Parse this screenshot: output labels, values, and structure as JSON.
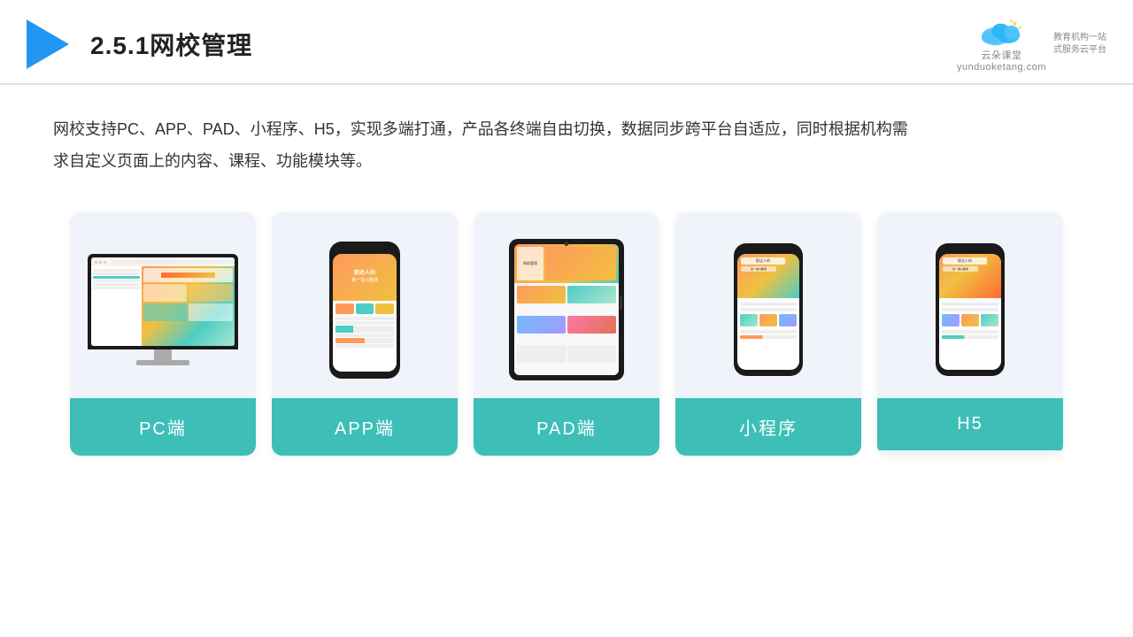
{
  "header": {
    "title": "2.5.1网校管理",
    "logo_name": "云朵课堂",
    "logo_sub": "yunduoketang.com",
    "logo_tagline": "教育机构一站\n式服务云平台"
  },
  "description": {
    "text": "网校支持PC、APP、PAD、小程序、H5，实现多端打通，产品各终端自由切换，数据同步跨平台自适应，同时根据机构需求自定义页面上的内容、课程、功能模块等。"
  },
  "cards": [
    {
      "id": "pc",
      "label": "PC端"
    },
    {
      "id": "app",
      "label": "APP端"
    },
    {
      "id": "pad",
      "label": "PAD端"
    },
    {
      "id": "miniapp",
      "label": "小程序"
    },
    {
      "id": "h5",
      "label": "H5"
    }
  ],
  "colors": {
    "accent": "#3dbfb8",
    "header_line": "#e0e0e0",
    "bg_card": "#f0f4fa"
  }
}
